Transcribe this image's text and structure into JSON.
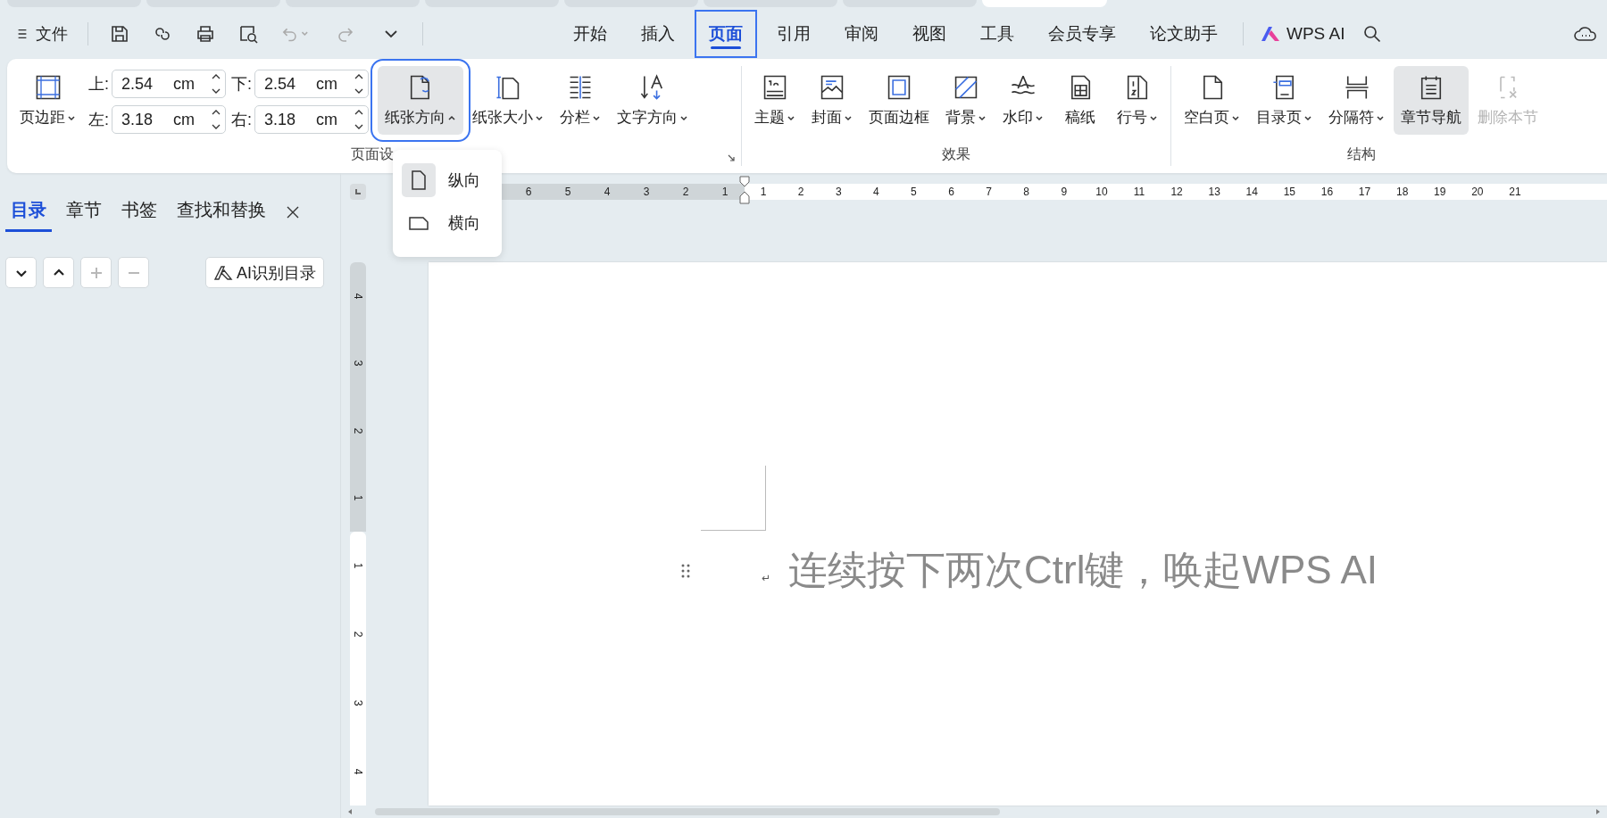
{
  "document_tabs": [
    {
      "selected": false
    },
    {
      "selected": false
    },
    {
      "selected": false
    },
    {
      "selected": false
    },
    {
      "selected": false
    },
    {
      "selected": false
    },
    {
      "selected": false
    },
    {
      "selected": true
    }
  ],
  "menu_bar": {
    "file_menu": "文件",
    "tabs": [
      {
        "label": "开始",
        "selected": false,
        "highlighted": false
      },
      {
        "label": "插入",
        "selected": false,
        "highlighted": false
      },
      {
        "label": "页面",
        "selected": true,
        "highlighted": true
      },
      {
        "label": "引用",
        "selected": false,
        "highlighted": false
      },
      {
        "label": "审阅",
        "selected": false,
        "highlighted": false
      },
      {
        "label": "视图",
        "selected": false,
        "highlighted": false
      },
      {
        "label": "工具",
        "selected": false,
        "highlighted": false
      },
      {
        "label": "会员专享",
        "selected": false,
        "highlighted": false
      },
      {
        "label": "论文助手",
        "selected": false,
        "highlighted": false
      }
    ],
    "wps_ai": "WPS AI"
  },
  "ribbon": {
    "margins": {
      "button": {
        "label": "页边距",
        "dropdown": true
      },
      "fields": [
        {
          "label": "上:",
          "value": "2.54",
          "unit": "cm"
        },
        {
          "label": "下:",
          "value": "2.54",
          "unit": "cm"
        },
        {
          "label": "左:",
          "value": "3.18",
          "unit": "cm"
        },
        {
          "label": "右:",
          "value": "3.18",
          "unit": "cm"
        }
      ]
    },
    "groups": [
      {
        "title": "页面设",
        "buttons": [
          {
            "label": "纸张方向",
            "dropdown": true,
            "expanded": true,
            "pressed": true,
            "disabled": false
          },
          {
            "label": "纸张大小",
            "dropdown": true,
            "expanded": false,
            "pressed": false,
            "disabled": false
          },
          {
            "label": "分栏",
            "dropdown": true,
            "expanded": false,
            "pressed": false,
            "disabled": false
          },
          {
            "label": "文字方向",
            "dropdown": true,
            "expanded": false,
            "pressed": false,
            "disabled": false
          }
        ]
      },
      {
        "title": "效果",
        "buttons": [
          {
            "label": "主题",
            "dropdown": true,
            "expanded": false,
            "pressed": false,
            "disabled": false
          },
          {
            "label": "封面",
            "dropdown": true,
            "expanded": false,
            "pressed": false,
            "disabled": false
          },
          {
            "label": "页面边框",
            "dropdown": false,
            "pressed": false,
            "disabled": false
          },
          {
            "label": "背景",
            "dropdown": true,
            "expanded": false,
            "pressed": false,
            "disabled": false
          },
          {
            "label": "水印",
            "dropdown": true,
            "expanded": false,
            "pressed": false,
            "disabled": false
          },
          {
            "label": "稿纸",
            "dropdown": false,
            "pressed": false,
            "disabled": false
          },
          {
            "label": "行号",
            "dropdown": true,
            "expanded": false,
            "pressed": false,
            "disabled": false
          }
        ]
      },
      {
        "title": "结构",
        "buttons": [
          {
            "label": "空白页",
            "dropdown": true,
            "expanded": false,
            "pressed": false,
            "disabled": false
          },
          {
            "label": "目录页",
            "dropdown": true,
            "expanded": false,
            "pressed": false,
            "disabled": false
          },
          {
            "label": "分隔符",
            "dropdown": true,
            "expanded": false,
            "pressed": false,
            "disabled": false
          },
          {
            "label": "章节导航",
            "dropdown": false,
            "pressed": true,
            "disabled": false
          },
          {
            "label": "删除本节",
            "dropdown": false,
            "pressed": false,
            "disabled": true
          }
        ]
      }
    ]
  },
  "orientation_menu": {
    "items": [
      {
        "label": "纵向",
        "selected": true
      },
      {
        "label": "横向",
        "selected": false
      }
    ]
  },
  "nav_panel": {
    "tabs": [
      {
        "label": "目录",
        "selected": true
      },
      {
        "label": "章节",
        "selected": false
      },
      {
        "label": "书签",
        "selected": false
      },
      {
        "label": "查找和替换",
        "selected": false
      }
    ],
    "tool_buttons": [
      {
        "kind": "down",
        "disabled": false
      },
      {
        "kind": "up",
        "disabled": false
      },
      {
        "kind": "plus",
        "disabled": true
      },
      {
        "kind": "minus",
        "disabled": true
      }
    ],
    "ai_button": "AI识别目录"
  },
  "ruler": {
    "left_labels": [
      "6",
      "5",
      "4",
      "3",
      "2",
      "1"
    ],
    "right_labels": [
      "1",
      "2",
      "3",
      "4",
      "5",
      "6",
      "7",
      "8",
      "9",
      "10",
      "11",
      "12",
      "13",
      "14",
      "15",
      "16",
      "17",
      "18",
      "19",
      "20",
      "21"
    ]
  },
  "vertical_ruler": {
    "top_labels": [
      "4",
      "3",
      "2",
      "1"
    ],
    "bottom_labels": [
      "1",
      "2",
      "3",
      "4"
    ]
  },
  "document": {
    "paragraph_mark": "↵",
    "text": "连续按下两次Ctrl键，唤起WPS AI"
  }
}
